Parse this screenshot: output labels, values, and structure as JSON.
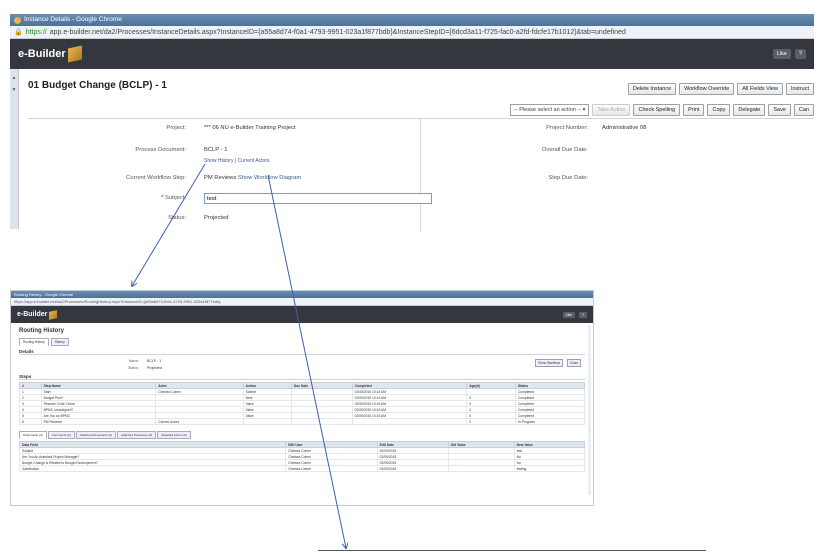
{
  "window1": {
    "title": "Instance Details - Google Chrome",
    "url_https": "https://",
    "url_rest": "app.e-builder.net/da2/Processes/InstanceDetails.aspx?InstanceID={a55a8d74-f0a1-4793-9951-023a1f877bdb}&InstanceStepID={6dcd3a11-f725-fac0-a2fd-fdcfe17b1012}&tab=undefined",
    "logo": "e-Builder",
    "header_buttons": [
      "Like",
      "?"
    ],
    "page_title": "01 Budget Change (BCLP) - 1",
    "toolbar1": [
      "Delete Instance",
      "Workflow Override",
      "All Fields View",
      "Instruct"
    ],
    "action_select": "-- Please select an action --",
    "toolbar2": [
      "Take Action",
      "Check Spelling",
      "Print",
      "Copy",
      "Delegate",
      "Save",
      "Can"
    ],
    "form": {
      "project_label": "Project:",
      "project_value": "*** 06 NU e-Builder Training Project",
      "process_label": "Process Document:",
      "process_value": "BCLP - 1",
      "show_history": "Show History",
      "sep": "|",
      "current_actors": "Current Actors",
      "step_label": "Current Workflow Step:",
      "step_value": "PM Reviews",
      "show_diagram": "Show Workflow Diagram",
      "subject_label": "Subject:",
      "subject_required": "*",
      "subject_value": "test",
      "status_label": "Status:",
      "status_value": "Projected",
      "project_number_label": "Project Number:",
      "project_number_value": "Administrative 08",
      "overall_due_label": "Overall Due Date:",
      "step_due_label": "Step Due Date:"
    }
  },
  "window2": {
    "title": "Routing History - Google Chrome",
    "url": "https://app.e-builder.net/da2/Processes/RoutingHistory.aspx?InstanceID={a55a8d74-f0a1-4793-9951-023a1f877bdb}",
    "logo": "e-Builder",
    "header_buttons": [
      "Like",
      "?"
    ],
    "heading": "Routing History",
    "tabs": [
      "Routing History",
      "History"
    ],
    "details_heading": "Details",
    "details": [
      {
        "k": "Name:",
        "v": "BCLP - 1"
      },
      {
        "k": "Status:",
        "v": "Projected"
      }
    ],
    "detail_buttons": [
      "Show Workflow",
      "Close"
    ],
    "steps_heading": "Steps",
    "steps_columns": [
      "#",
      "Step Name",
      "Actor",
      "Action",
      "Due Date",
      "Completed",
      "Age(d)",
      "Status"
    ],
    "steps_rows": [
      [
        "1",
        "Start",
        "Chelsea Cohen",
        "Submit",
        "",
        "02/05/2015 10:14 AM",
        "",
        "Completed"
      ],
      [
        "2",
        "Budget Plan?",
        "",
        "Next",
        "",
        "02/05/2015 10:14 AM",
        "0",
        "Completed"
      ],
      [
        "3",
        "Resume Code Check",
        "",
        "Valve",
        "",
        "02/05/2015 10:15 AM",
        "0",
        "Completed"
      ],
      [
        "4",
        "BPMC Unassigned?",
        "",
        "Valve",
        "",
        "02/05/2015 10:15 AM",
        "0",
        "Completed"
      ],
      [
        "5",
        "Are You an BPMC",
        "",
        "Valve",
        "",
        "02/05/2015 10:16 AM",
        "0",
        "Completed"
      ],
      [
        "6",
        "PM Reviews",
        "Current Actors",
        "",
        "",
        "",
        "0",
        "In Progress"
      ]
    ],
    "bottom_tabs": [
      "Data Fields (4)",
      "Comments (0)",
      "Attached Documents (0)",
      "Attached Processes (0)",
      "Attached Forms (0)"
    ],
    "fields_columns": [
      "Data Field",
      "Edit User",
      "Edit Date",
      "Old Value",
      "New Value"
    ],
    "fields_rows": [
      [
        "Subject",
        "Chelsea Cohen",
        "02/05/2015",
        "",
        "test"
      ],
      [
        "Are You An Assistant Project Manager?",
        "Chelsea Cohen",
        "02/05/2015",
        "",
        "No"
      ],
      [
        "Budget Change is Related to Budget Development?",
        "Chelsea Cohen",
        "02/05/2015",
        "",
        "No"
      ],
      [
        "Justification",
        "Chelsea Cohen",
        "02/05/2015",
        "",
        "testing"
      ]
    ]
  },
  "colors": {
    "header_dark": "#34373d",
    "titlebar_blue": "#4e7197",
    "link_blue": "#3a5c8a",
    "arrow_blue": "#3b63a8"
  }
}
